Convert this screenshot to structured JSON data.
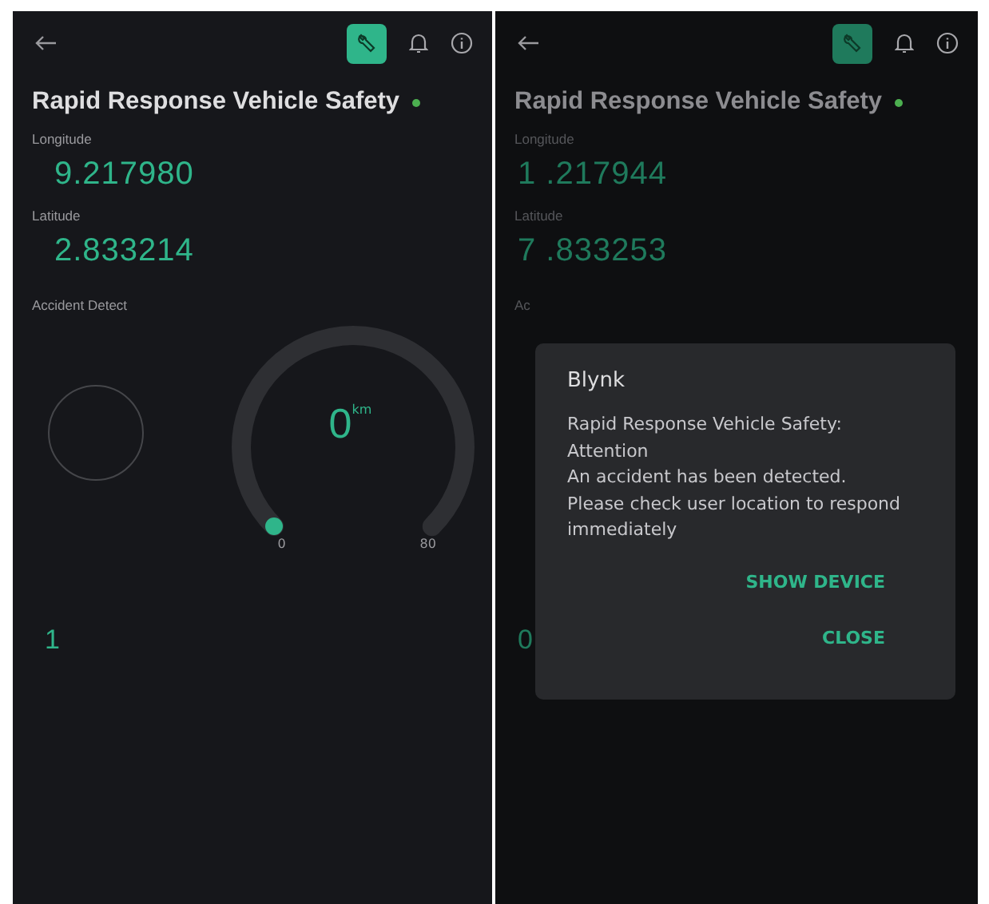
{
  "screens": [
    {
      "dimmed": false,
      "title": "Rapid Response Vehicle Safety",
      "online": true,
      "settings_active": true,
      "fields": [
        {
          "label": "Longitude",
          "value": "9.217980"
        },
        {
          "label": "Latitude",
          "value": "2.833214"
        }
      ],
      "accident_label": "Accident Detect",
      "led_on": false,
      "gauge": {
        "value": "0",
        "unit": "km",
        "min": "0",
        "max": "80"
      },
      "accident_value": "1"
    },
    {
      "dimmed": true,
      "title": "Rapid Response Vehicle Safety",
      "online": true,
      "settings_active": true,
      "fields": [
        {
          "label": "Longitude",
          "value": "1 .217944"
        },
        {
          "label": "Latitude",
          "value": "7 .833253"
        }
      ],
      "accident_label": "Ac",
      "accident_value": "0",
      "dialog": {
        "title": "Blynk",
        "lines": [
          "Rapid Response Vehicle Safety:",
          "Attention",
          "An accident has been detected.",
          "Please check user location to respond immediately"
        ],
        "actions": [
          "SHOW DEVICE",
          "CLOSE"
        ]
      }
    }
  ]
}
